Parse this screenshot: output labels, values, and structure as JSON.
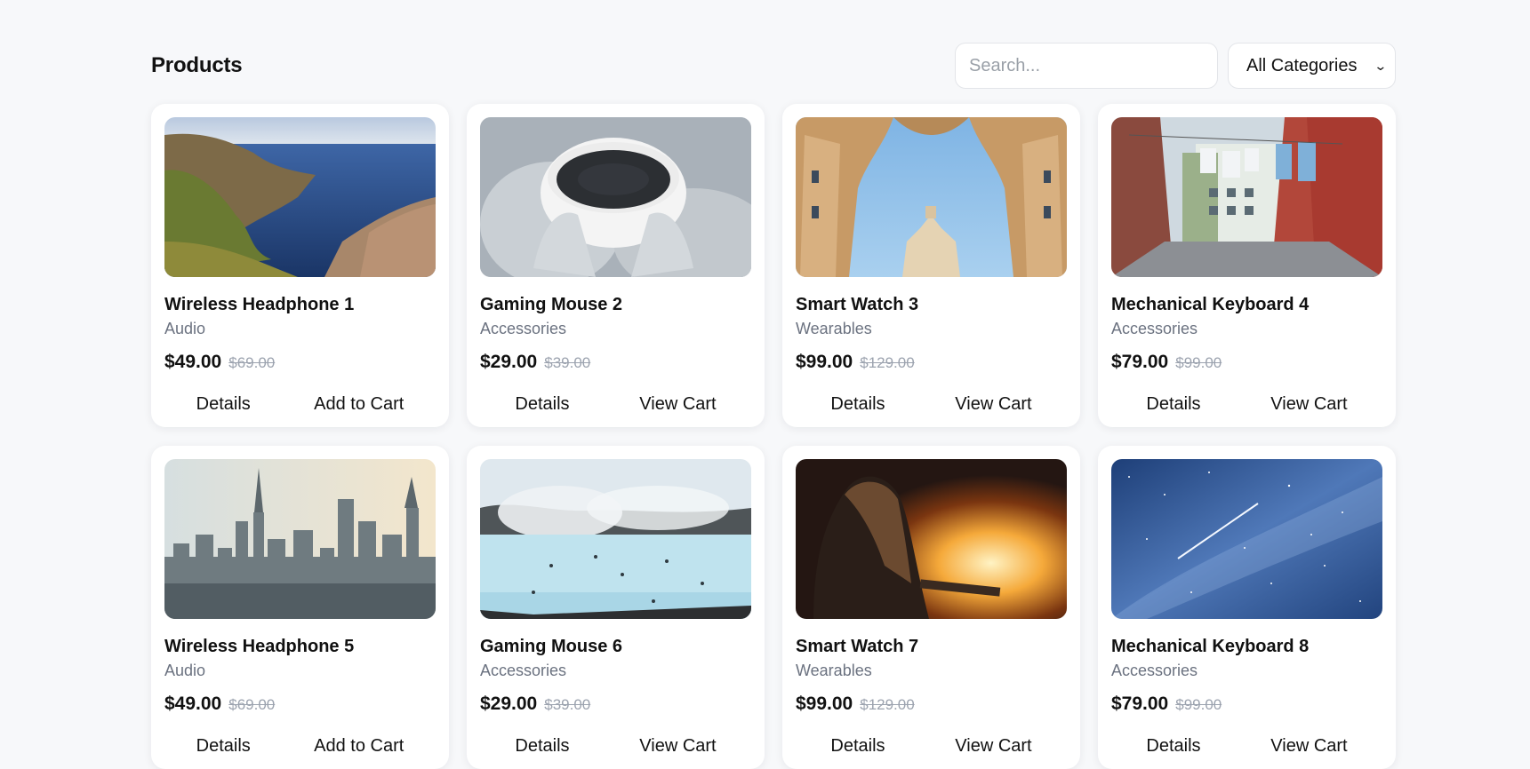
{
  "header": {
    "title": "Products",
    "search_placeholder": "Search...",
    "category_selected": "All Categories"
  },
  "products": [
    {
      "name": "Wireless Headphone 1",
      "category": "Audio",
      "price": "$49.00",
      "old_price": "$69.00",
      "details_label": "Details",
      "cart_label": "Add to Cart",
      "image": "coastal-cliffs"
    },
    {
      "name": "Gaming Mouse 2",
      "category": "Accessories",
      "price": "$29.00",
      "old_price": "$39.00",
      "details_label": "Details",
      "cart_label": "View Cart",
      "image": "coffee-cup-knit-gloves"
    },
    {
      "name": "Smart Watch 3",
      "category": "Wearables",
      "price": "$99.00",
      "old_price": "$129.00",
      "details_label": "Details",
      "cart_label": "View Cart",
      "image": "buildings-looking-up"
    },
    {
      "name": "Mechanical Keyboard 4",
      "category": "Accessories",
      "price": "$79.00",
      "old_price": "$99.00",
      "details_label": "Details",
      "cart_label": "View Cart",
      "image": "street-laundry"
    },
    {
      "name": "Wireless Headphone 5",
      "category": "Audio",
      "price": "$49.00",
      "old_price": "$69.00",
      "details_label": "Details",
      "cart_label": "Add to Cart",
      "image": "city-skyline"
    },
    {
      "name": "Gaming Mouse 6",
      "category": "Accessories",
      "price": "$29.00",
      "old_price": "$39.00",
      "details_label": "Details",
      "cart_label": "View Cart",
      "image": "hot-spring-lagoon"
    },
    {
      "name": "Smart Watch 7",
      "category": "Wearables",
      "price": "$99.00",
      "old_price": "$129.00",
      "details_label": "Details",
      "cart_label": "View Cart",
      "image": "person-by-fire"
    },
    {
      "name": "Mechanical Keyboard 8",
      "category": "Accessories",
      "price": "$79.00",
      "old_price": "$99.00",
      "details_label": "Details",
      "cart_label": "View Cart",
      "image": "starry-sky-meteor"
    }
  ]
}
